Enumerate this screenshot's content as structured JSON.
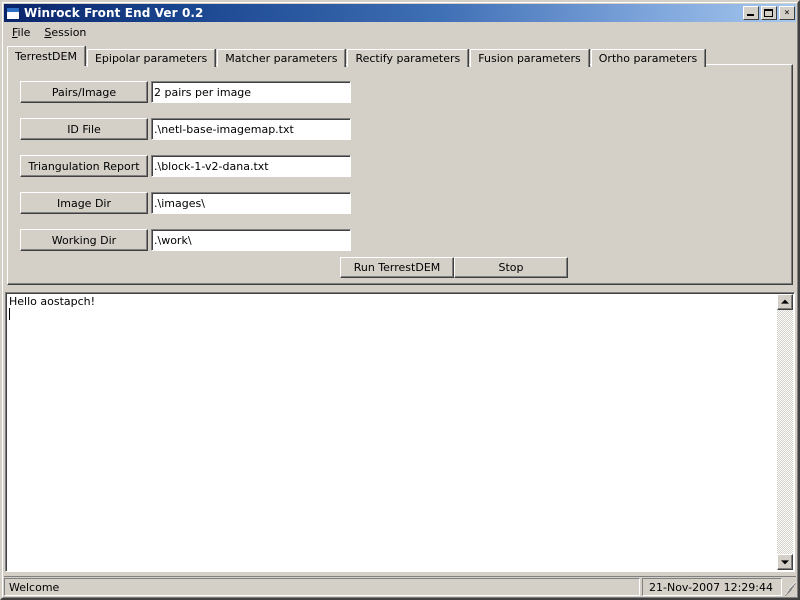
{
  "window": {
    "title": "Winrock Front End Ver 0.2",
    "icon": "window-icon",
    "buttons": {
      "minimize": "minimize-icon",
      "maximize": "maximize-icon",
      "close": "×"
    }
  },
  "menu": {
    "items": [
      {
        "label": "File",
        "mnemonic": "F"
      },
      {
        "label": "Session",
        "mnemonic": "S"
      }
    ]
  },
  "tabs": [
    {
      "label": "TerrestDEM",
      "active": true
    },
    {
      "label": "Epipolar parameters",
      "active": false
    },
    {
      "label": "Matcher parameters",
      "active": false
    },
    {
      "label": "Rectify parameters",
      "active": false
    },
    {
      "label": "Fusion parameters",
      "active": false
    },
    {
      "label": "Ortho parameters",
      "active": false
    }
  ],
  "form": {
    "rows": [
      {
        "button": "Pairs/Image",
        "value": "2 pairs per image"
      },
      {
        "button": "ID File",
        "value": ".\\netl-base-imagemap.txt"
      },
      {
        "button": "Triangulation Report",
        "value": ".\\block-1-v2-dana.txt"
      },
      {
        "button": "Image Dir",
        "value": ".\\images\\"
      },
      {
        "button": "Working Dir",
        "value": ".\\work\\"
      }
    ],
    "run_button": "Run TerrestDEM",
    "stop_button": "Stop"
  },
  "log": {
    "text": "Hello aostapch!"
  },
  "scrollbar": {
    "up": "scroll-up-icon",
    "down": "scroll-down-icon"
  },
  "statusbar": {
    "message": "Welcome",
    "datetime": "21-Nov-2007  12:29:44"
  },
  "colors": {
    "face": "#d4d0c8",
    "title_start": "#0a246a",
    "title_end": "#a6c8ee",
    "field_bg": "#ffffff",
    "text": "#000000"
  }
}
